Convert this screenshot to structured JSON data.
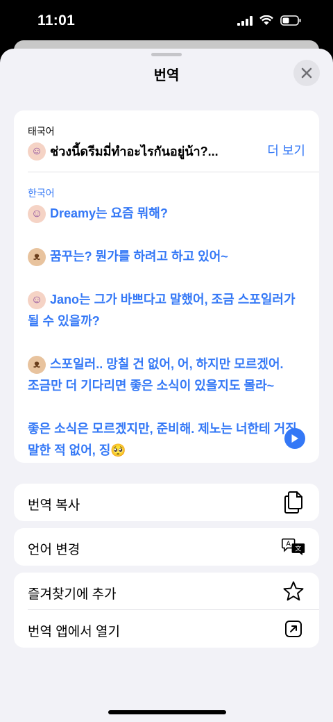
{
  "status_bar": {
    "time": "11:01"
  },
  "sheet": {
    "title": "번역"
  },
  "source": {
    "language": "태국어",
    "text": "ช่วงนี้ดรีมมี่ทำอะไรกันอยู่น้า?...",
    "more_label": "더 보기"
  },
  "target": {
    "language": "한국어",
    "paragraphs": [
      {
        "emoji": "person-icon",
        "text": "Dreamy는 요즘 뭐해?"
      },
      {
        "emoji": "dog-icon",
        "text": "꿈꾸는? 뭔가를 하려고 하고 있어~"
      },
      {
        "emoji": "person-icon",
        "text": "Jano는 그가 바쁘다고 말했어, 조금 스포일러가 될 수 있을까?"
      },
      {
        "emoji": "dog-icon",
        "text": "스포일러.. 망칠 건 없어, 어, 하지만 모르겠어. 조금만 더 기다리면 좋은 소식이 있을지도 몰라~"
      },
      {
        "emoji": "",
        "text": "좋은 소식은 모르겠지만, 준비해. 제노는 너한테 거짓말한 적 없어, 징",
        "trailing_emoji": "🥺"
      }
    ]
  },
  "actions": {
    "copy": {
      "label": "번역 복사",
      "icon": "copy-icon"
    },
    "change_language": {
      "label": "언어 변경",
      "icon": "translate-icon"
    },
    "favorite": {
      "label": "즐겨찾기에 추가",
      "icon": "star-icon"
    },
    "open_app": {
      "label": "번역 앱에서 열기",
      "icon": "open-external-icon"
    }
  },
  "colors": {
    "accent": "#3478f6",
    "background": "#f2f2f7"
  }
}
